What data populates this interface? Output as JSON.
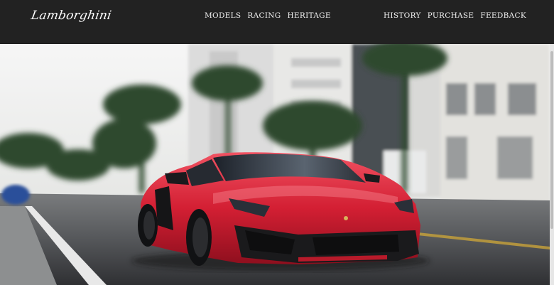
{
  "brand": {
    "logo_text": "Lamborghini"
  },
  "nav": {
    "center": [
      "MODELS",
      "RACING",
      "HERITAGE"
    ],
    "right": [
      "HISTORY",
      "PURCHASE",
      "FEEDBACK"
    ]
  },
  "hero": {
    "image": "red-lamborghini-aventador-street-photo"
  },
  "colors": {
    "navbar": "#222222",
    "car": "#d31f33",
    "text": "#ffffff"
  }
}
